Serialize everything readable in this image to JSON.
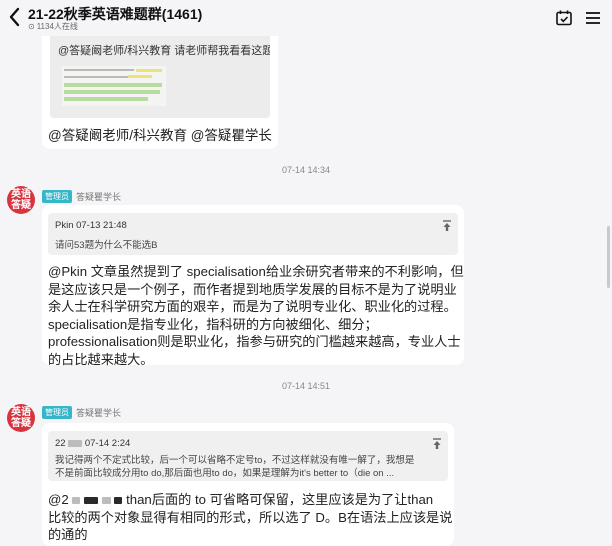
{
  "header": {
    "title": "21-22秋季英语难题群(1461)",
    "subtitle": "1134人在线",
    "back_icon": "chevron-left-icon",
    "calendar_icon": "calendar-check-icon",
    "menu_icon": "menu-icon"
  },
  "messages": [
    {
      "quote_text": "@答疑阚老师/科兴教育 请老师帮我看看这题",
      "body": "@答疑阚老师/科兴教育 @答疑瞿学长"
    },
    {
      "time": "07-14 14:34",
      "avatar_text": "英语答疑",
      "role": "管理员",
      "sender": "答疑瞿学长",
      "reply_head": "Pkin 07-13 21:48",
      "reply_line1": "请问53题为什么不能选B",
      "body_lines": [
        "@Pkin  文章虽然提到了 specialisation给业余研究者带来的不利影响，但",
        "是这应该只是一个例子，而作者提到地质学发展的目标不是为了说明业",
        "余人士在科学研究方面的艰辛，而是为了说明专业化、职业化的过程。",
        "specialisation是指专业化，指科研的方向被细化、细分；",
        "professionalisation则是职业化，指参与研究的门槛越来越高，专业人士",
        "的占比越来越大。"
      ]
    },
    {
      "time": "07-14 14:51",
      "avatar_text": "英语答疑",
      "role": "管理员",
      "sender": "答疑瞿学长",
      "reply_head_prefix": "22",
      "reply_head_suffix": "07-14 2:24",
      "reply_line1": "我记得两个不定式比较，后一个可以省略不定号to，不过这样就没有唯一解了，我想是",
      "reply_line2": "不是前面比较成分用to do,那后面也用to do，如果是理解为it's better to（die on ...",
      "body_prefix": "@2",
      "body_line1_rest": "than后面的 to 可省略可保留，这里应该是为了让than",
      "body_lines": [
        "比较的两个对象显得有相同的形式，所以选了 D。B在语法上应该是说",
        "的通的"
      ]
    }
  ],
  "colors": {
    "background": "#f5f5f7",
    "bubble": "#ffffff",
    "avatar": "#d8343f",
    "role_badge": "#37b6c9"
  }
}
